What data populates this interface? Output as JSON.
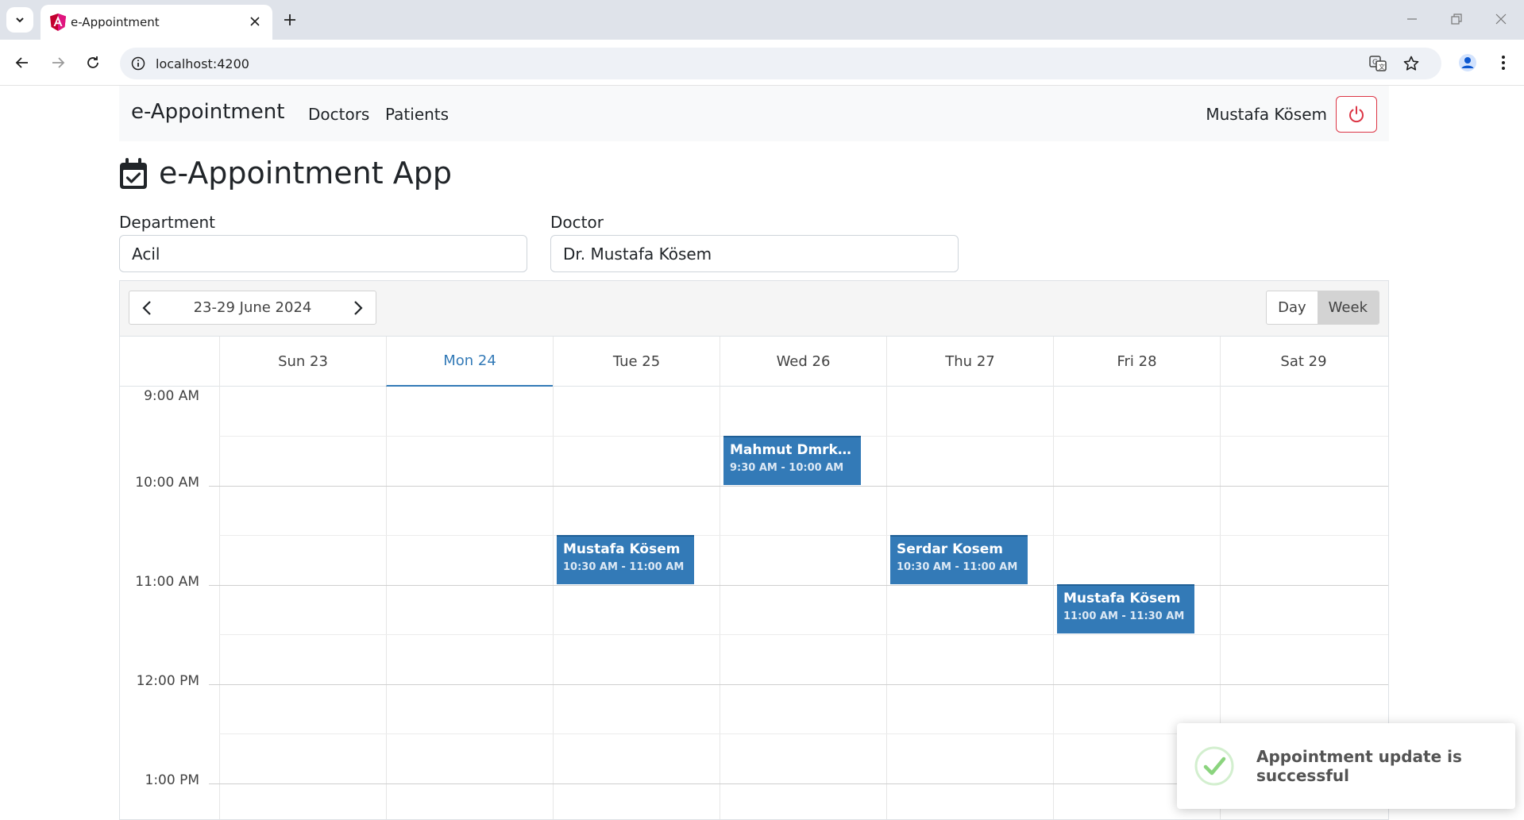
{
  "browser": {
    "tab_title": "e-Appointment",
    "url": "localhost:4200"
  },
  "navbar": {
    "brand": "e-Appointment",
    "links": [
      "Doctors",
      "Patients"
    ],
    "user_name": "Mustafa Kösem"
  },
  "page": {
    "title": "e-Appointment App",
    "department_label": "Department",
    "department_value": "Acil",
    "doctor_label": "Doctor",
    "doctor_value": "Dr. Mustafa Kösem"
  },
  "scheduler": {
    "date_range": "23-29 June 2024",
    "views": [
      "Day",
      "Week"
    ],
    "active_view": "Week",
    "days": [
      "Sun 23",
      "Mon 24",
      "Tue 25",
      "Wed 26",
      "Thu 27",
      "Fri 28",
      "Sat 29"
    ],
    "today": "Mon 24",
    "times": [
      "9:00 AM",
      "10:00 AM",
      "11:00 AM",
      "12:00 PM",
      "1:00 PM"
    ],
    "appointments": [
      {
        "name": "Mahmut Dmrkır...",
        "time": "9:30 AM - 10:00 AM",
        "day": "Wed 26"
      },
      {
        "name": "Mustafa Kösem",
        "time": "10:30 AM - 11:00 AM",
        "day": "Tue 25"
      },
      {
        "name": "Serdar Kosem",
        "time": "10:30 AM - 11:00 AM",
        "day": "Thu 27"
      },
      {
        "name": "Mustafa Kösem",
        "time": "11:00 AM - 11:30 AM",
        "day": "Fri 28"
      }
    ],
    "accent_color": "#337ab7"
  },
  "toast": {
    "message": "Appointment update is successful",
    "icon": "check-circle-icon"
  }
}
